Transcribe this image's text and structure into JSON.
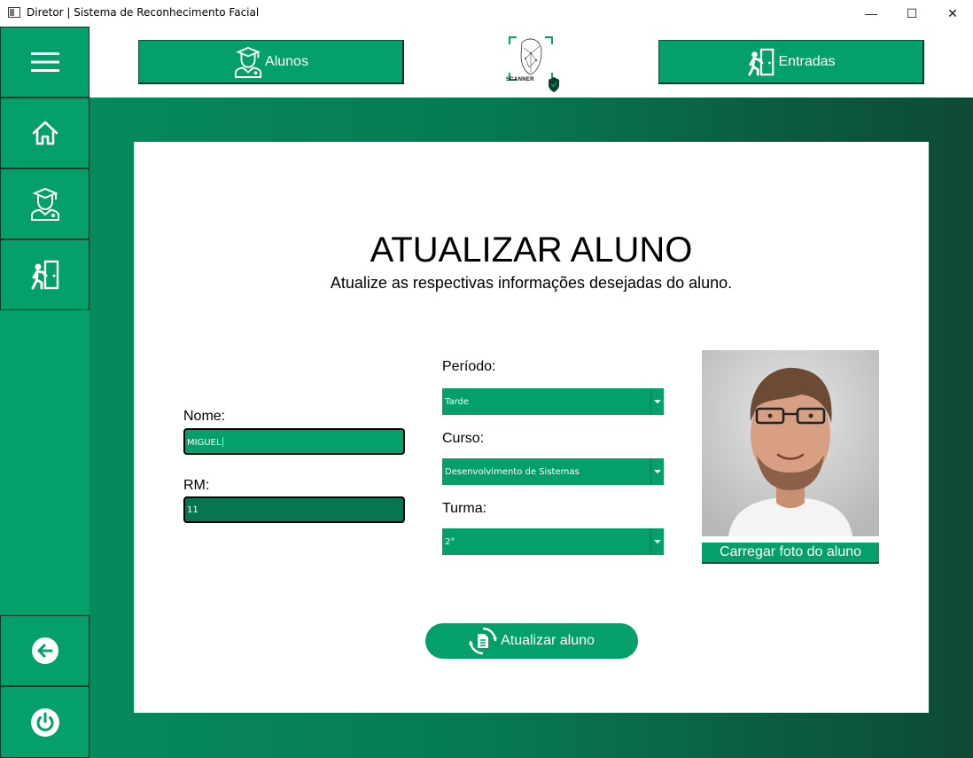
{
  "window": {
    "title": "Diretor | Sistema de Reconhecimento Facial",
    "minimize": "—",
    "maximize": "☐",
    "close": "✕"
  },
  "sidebar": {
    "items": [
      {
        "name": "menu",
        "icon": "hamburger-menu-icon"
      },
      {
        "name": "home",
        "icon": "home-icon"
      },
      {
        "name": "students",
        "icon": "student-graduate-icon"
      },
      {
        "name": "entries",
        "icon": "person-entering-door-icon"
      },
      {
        "name": "back",
        "icon": "arrow-left-circle-icon"
      },
      {
        "name": "power",
        "icon": "power-icon"
      }
    ]
  },
  "header": {
    "alunos_label": "Alunos",
    "entradas_label": "Entradas",
    "logo_text": "SCANNER"
  },
  "form": {
    "title": "ATUALIZAR ALUNO",
    "subtitle": "Atualize as respectivas informações desejadas do aluno.",
    "nome_label": "Nome:",
    "nome_value": "MIGUEL",
    "rm_label": "RM:",
    "rm_value": "11",
    "periodo_label": "Período:",
    "periodo_value": "Tarde",
    "curso_label": "Curso:",
    "curso_value": "Desenvolvimento de Sistemas",
    "turma_label": "Turma:",
    "turma_value": "2°",
    "upload_label": "Carregar foto do aluno",
    "submit_label": "Atualizar aluno"
  },
  "colors": {
    "primary_green": "#05a06a",
    "dark_green": "#0e4a37",
    "rm_field_green": "#077650"
  }
}
